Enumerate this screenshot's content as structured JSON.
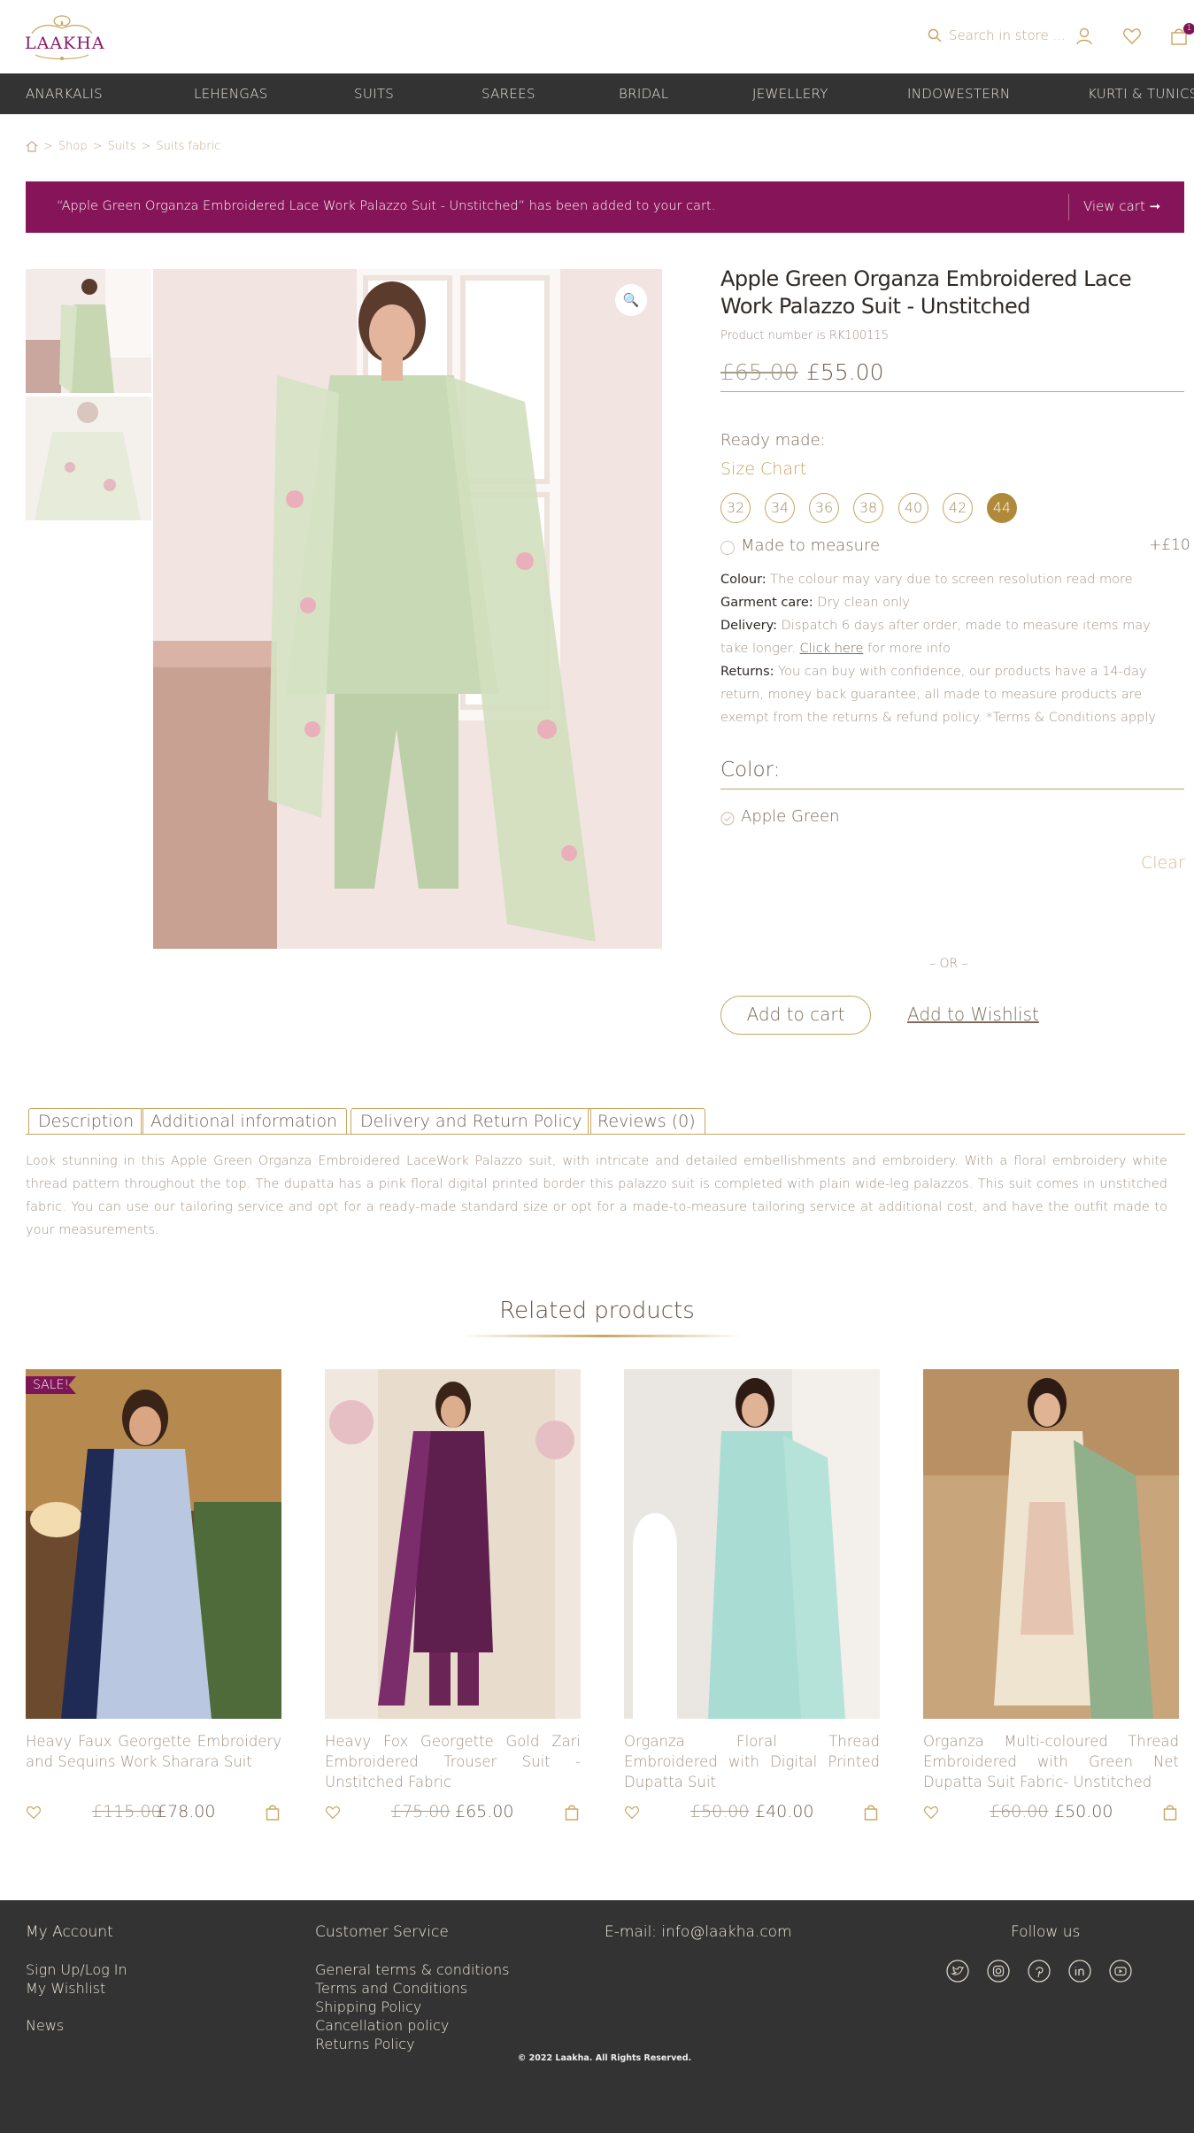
{
  "brand": {
    "logo_text": "LAAKHA"
  },
  "header": {
    "search_placeholder": "Search in store ...",
    "cart_count": "1"
  },
  "nav": [
    "ANARKALIS",
    "LEHENGAS",
    "SUITS",
    "SAREES",
    "BRIDAL",
    "JEWELLERY",
    "INDOWESTERN",
    "KURTI & TUNICS"
  ],
  "breadcrumb": {
    "sep": ">",
    "items": [
      "Shop",
      "Suits",
      "Suits fabric"
    ]
  },
  "notice": {
    "message": "“Apple Green Organza Embroidered Lace Work Palazzo Suit - Unstitched” has been added to your cart.",
    "button": "View cart"
  },
  "product": {
    "title": "Apple Green Organza Embroidered Lace Work Palazzo Suit - Unstitched",
    "number": "Product number is RK100115",
    "old_price": "£65.00",
    "price": "£55.00",
    "ready_made_label": "Ready made:",
    "size_chart": "Size Chart",
    "sizes": [
      "32",
      "34",
      "36",
      "38",
      "40",
      "42",
      "44"
    ],
    "selected_size": "44",
    "made_to_measure": "Made to measure",
    "made_to_measure_price": "+£10",
    "colour_label": "Colour:",
    "colour_text": "The colour may vary due to screen resolution read more",
    "care_label": "Garment care:",
    "care_text": "Dry clean only",
    "delivery_label": "Delivery:",
    "delivery_text": "Dispatch 6 days after order, made to measure items may take longer.",
    "delivery_link": "Click here",
    "delivery_after": "for more info",
    "returns_label": "Returns:",
    "returns_text": "You can buy with confidence, our products have a 14-day return, money back guarantee, all made to measure products are exempt from the returns & refund policy. *Terms & Conditions apply",
    "color_heading": "Color:",
    "color_option": "Apple Green",
    "clear": "Clear",
    "or": "– OR –",
    "add_to_cart": "Add to cart",
    "add_to_wishlist": "Add to Wishlist"
  },
  "tabs": [
    "Description",
    "Additional information",
    "Delivery and Return Policy",
    "Reviews (0)"
  ],
  "description": "Look stunning in this Apple Green Organza Embroidered LaceWork Palazzo suit, with intricate and detailed embellishments and embroidery. With a floral embroidery white thread pattern throughout the top. The dupatta has a pink floral digital printed border this palazzo suit is completed with plain wide-leg palazzos. This suit comes in unstitched fabric. You can use our tailoring service and opt for a ready-made standard size or opt for a made-to-measure tailoring service at additional cost, and have the outfit made to your measurements.",
  "related": {
    "heading": "Related products",
    "items": [
      {
        "badge": "SALE!",
        "name": "Heavy Faux Georgette Embroidery and Sequins Work Sharara Suit",
        "old": "£115.00",
        "price": "£78.00"
      },
      {
        "badge": "",
        "name": "Heavy Fox Georgette Gold Zari Embroidered Trouser Suit - Unstitched Fabric",
        "old": "£75.00",
        "price": "£65.00"
      },
      {
        "badge": "",
        "name": "Organza Floral Thread Embroidered with Digital Printed Dupatta Suit",
        "old": "£50.00",
        "price": "£40.00"
      },
      {
        "badge": "",
        "name": "Organza Multi-coloured Thread Embroidered with Green Net Dupatta Suit Fabric- Unstitched",
        "old": "£60.00",
        "price": "£50.00"
      }
    ]
  },
  "footer": {
    "my_account": "My Account",
    "account_links": [
      "Sign Up/Log In",
      "My Wishlist",
      "News"
    ],
    "customer_service": "Customer Service",
    "service_links": [
      "General terms & conditions",
      "Terms and Conditions",
      "Shipping Policy",
      "Cancellation policy",
      "Returns Policy"
    ],
    "email": "E-mail: info@laakha.com",
    "follow": "Follow us",
    "social_icons": [
      "twitter-icon",
      "instagram-icon",
      "pinterest-icon",
      "linkedin-icon",
      "youtube-icon"
    ],
    "copyright": "© 2022 Laakha. All Rights Reserved."
  },
  "colors": {
    "accent": "#c9a560",
    "plum": "#861458",
    "dark": "#333333"
  }
}
